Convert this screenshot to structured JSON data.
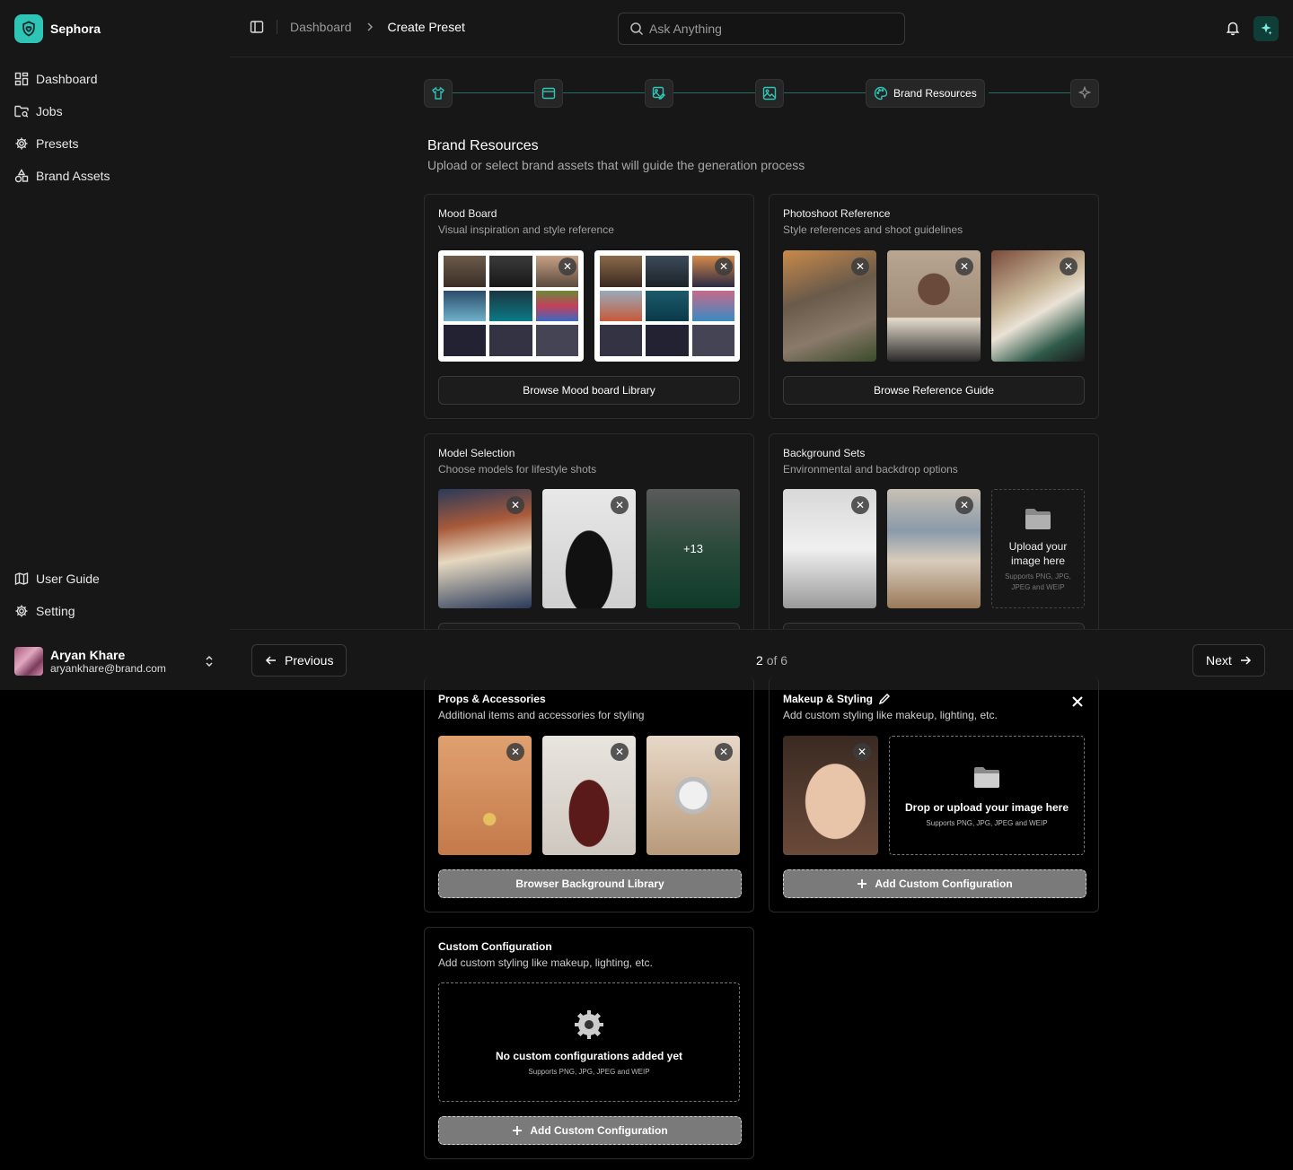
{
  "brand": {
    "name": "Sephora",
    "accent": "#2ec4b6"
  },
  "nav": {
    "items": [
      {
        "label": "Dashboard",
        "icon": "dashboard-icon"
      },
      {
        "label": "Jobs",
        "icon": "folder-search-icon"
      },
      {
        "label": "Presets",
        "icon": "gear-icon"
      },
      {
        "label": "Brand Assets",
        "icon": "shapes-icon"
      }
    ],
    "bottom": [
      {
        "label": "User Guide",
        "icon": "map-icon"
      },
      {
        "label": "Setting",
        "icon": "gear-icon"
      }
    ]
  },
  "user": {
    "name": "Aryan Khare",
    "email": "aryankhare@brand.com"
  },
  "topbar": {
    "breadcrumb": [
      "Dashboard",
      "Create Preset"
    ],
    "search_placeholder": "Ask Anything"
  },
  "stepper": {
    "steps": [
      {
        "icon": "shirt-icon"
      },
      {
        "icon": "browser-icon"
      },
      {
        "icon": "image-edit-icon"
      },
      {
        "icon": "image-icon"
      },
      {
        "icon": "palette-icon",
        "label": "Brand Resources",
        "active": true
      },
      {
        "icon": "sparkles-icon"
      }
    ]
  },
  "section": {
    "title": "Brand Resources",
    "subtitle": "Upload or select brand assets that will guide the generation process"
  },
  "cards": {
    "mood": {
      "title": "Mood Board",
      "subtitle": "Visual inspiration and style reference",
      "button": "Browse Mood board Library"
    },
    "photoshoot": {
      "title": "Photoshoot Reference",
      "subtitle": "Style references and shoot guidelines",
      "button": "Browse Reference Guide"
    },
    "model": {
      "title": "Model Selection",
      "subtitle": "Choose models for lifestyle shots",
      "more": "+13"
    },
    "background": {
      "title": "Background Sets",
      "subtitle": "Environmental and backdrop options",
      "upload_title": "Upload your image here",
      "upload_hint": "Supports PNG, JPG, JPEG and WEIP"
    },
    "props": {
      "title": "Props & Accessories",
      "subtitle": "Additional items and accessories for styling",
      "button": "Browser Background Library"
    },
    "makeup": {
      "title": "Makeup & Styling",
      "subtitle": "Add custom styling like makeup, lighting, etc.",
      "upload_title": "Drop or upload your image here",
      "upload_hint": "Supports PNG, JPG, JPEG and WEIP",
      "button": "Add Custom Configuration"
    },
    "custom": {
      "title": "Custom Configuration",
      "subtitle": "Add custom styling like makeup, lighting, etc.",
      "empty_title": "No custom configurations added yet",
      "empty_hint": "Supports PNG, JPG, JPEG and WEIP",
      "button": "Add Custom Configuration"
    }
  },
  "pager": {
    "previous": "Previous",
    "next": "Next",
    "current": "2",
    "total": "of 6"
  }
}
